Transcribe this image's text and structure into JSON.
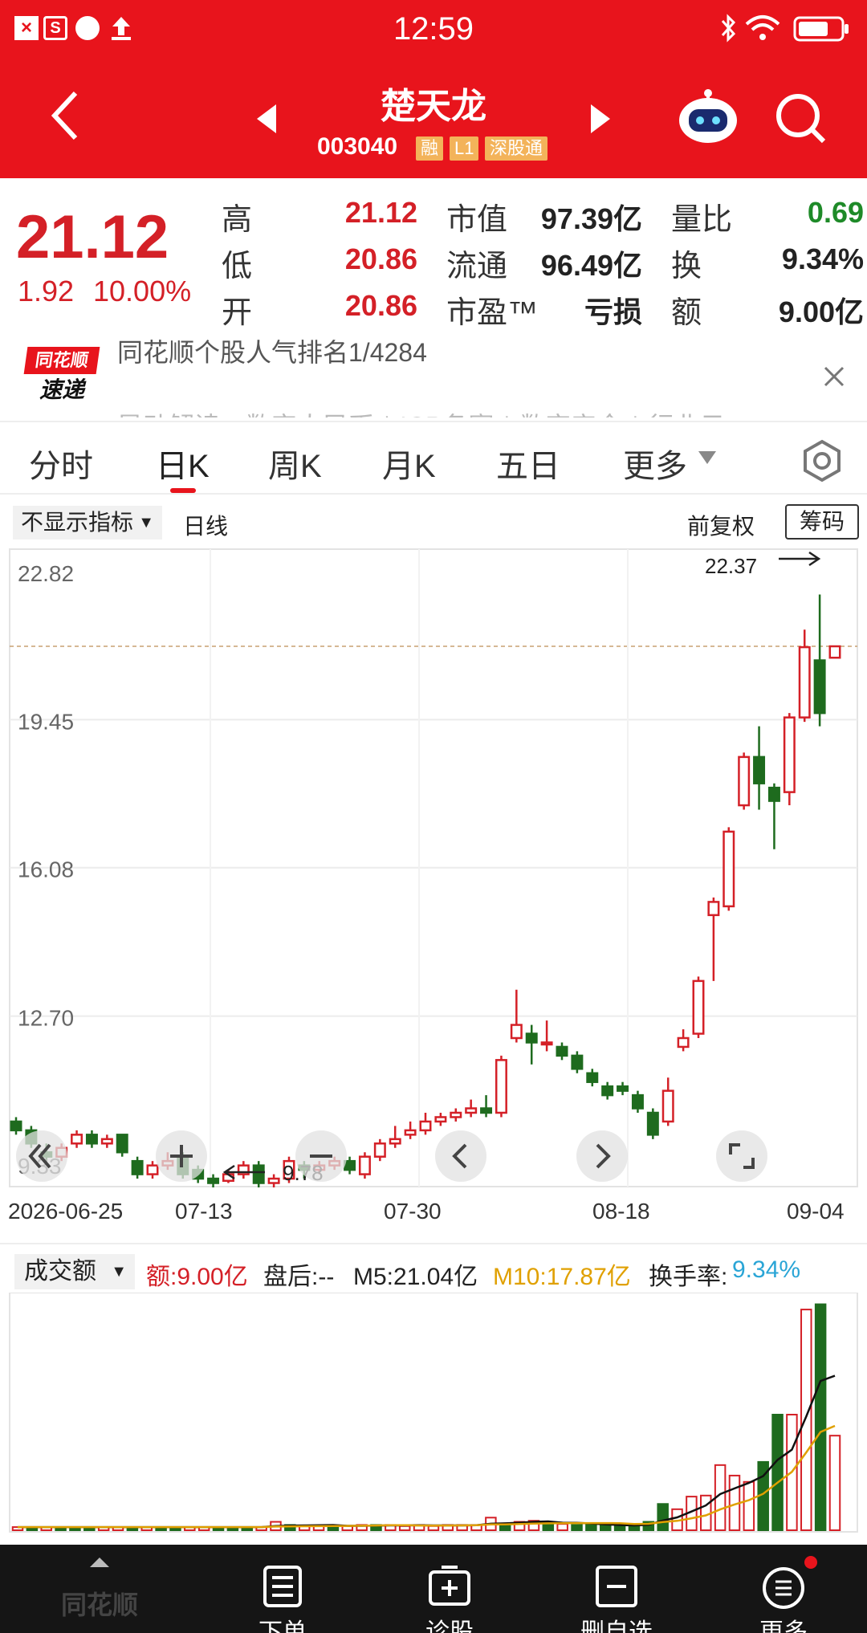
{
  "status_bar": {
    "time": "12:59"
  },
  "header": {
    "title": "楚天龙",
    "code": "003040",
    "badges": [
      "融",
      "L1",
      "深股通"
    ]
  },
  "quote": {
    "price": "21.12",
    "change": "1.92",
    "change_pct": "10.00%",
    "rows": [
      [
        {
          "label": "高",
          "value": "21.12"
        },
        {
          "label": "市值",
          "value": "97.39亿"
        },
        {
          "label": "量比",
          "value": "0.69"
        }
      ],
      [
        {
          "label": "低",
          "value": "20.86"
        },
        {
          "label": "流通",
          "value": "96.49亿"
        },
        {
          "label": "换",
          "value": "9.34%"
        }
      ],
      [
        {
          "label": "开",
          "value": "20.86"
        },
        {
          "label": "市盈™",
          "value": "亏损"
        },
        {
          "label": "额",
          "value": "9.00亿"
        }
      ]
    ]
  },
  "news": {
    "logo_top": "同花顺",
    "logo_bottom": "速递",
    "text": "同花顺个股人气排名1/4284",
    "text2": "异动解读：数字人民币＋ICP备案＋数字安全＋行业云"
  },
  "tabs": [
    "分时",
    "日K",
    "周K",
    "月K",
    "五日",
    "更多"
  ],
  "chart_toolbar": {
    "indicator": "不显示指标",
    "period": "日线",
    "adjust": "前复权",
    "chips": "筹码"
  },
  "chart_data": [
    {
      "type": "candlestick",
      "y_ticks": [
        "22.82",
        "19.45",
        "16.08",
        "12.70",
        "9.33"
      ],
      "x_labels": [
        "2026-06-25",
        "07-13",
        "07-30",
        "08-18",
        "09-04"
      ],
      "annotations": {
        "high": "22.37",
        "low": "9.78"
      },
      "last_close": 21.12,
      "candles": [
        [
          10.3,
          10.1,
          10.4,
          10.0
        ],
        [
          10.1,
          9.8,
          10.2,
          9.7
        ],
        [
          9.6,
          9.5,
          9.8,
          9.4
        ],
        [
          9.5,
          9.7,
          9.8,
          9.4
        ],
        [
          9.8,
          10.0,
          10.1,
          9.7
        ],
        [
          10.0,
          9.8,
          10.1,
          9.7
        ],
        [
          9.8,
          9.9,
          10.0,
          9.7
        ],
        [
          10.0,
          9.6,
          10.0,
          9.5
        ],
        [
          9.4,
          9.1,
          9.5,
          9.0
        ],
        [
          9.1,
          9.3,
          9.4,
          9.0
        ],
        [
          9.3,
          9.4,
          9.6,
          9.2
        ],
        [
          9.5,
          9.1,
          9.6,
          9.0
        ],
        [
          9.2,
          9.0,
          9.3,
          8.9
        ],
        [
          9.0,
          8.9,
          9.1,
          8.8
        ],
        [
          8.95,
          9.1,
          9.2,
          8.9
        ],
        [
          9.1,
          9.3,
          9.4,
          9.0
        ],
        [
          9.3,
          8.9,
          9.4,
          8.8
        ],
        [
          8.9,
          9.0,
          9.1,
          8.8
        ],
        [
          9.0,
          9.4,
          9.5,
          8.9
        ],
        [
          9.3,
          9.2,
          9.4,
          9.0
        ],
        [
          9.2,
          9.3,
          9.4,
          9.1
        ],
        [
          9.3,
          9.4,
          9.5,
          9.2
        ],
        [
          9.4,
          9.2,
          9.5,
          9.1
        ],
        [
          9.1,
          9.5,
          9.6,
          9.0
        ],
        [
          9.5,
          9.8,
          9.9,
          9.4
        ],
        [
          9.8,
          9.9,
          10.2,
          9.7
        ],
        [
          10.0,
          10.1,
          10.3,
          9.9
        ],
        [
          10.1,
          10.3,
          10.5,
          10.0
        ],
        [
          10.3,
          10.4,
          10.5,
          10.2
        ],
        [
          10.4,
          10.5,
          10.6,
          10.3
        ],
        [
          10.5,
          10.6,
          10.8,
          10.4
        ],
        [
          10.6,
          10.5,
          10.9,
          10.4
        ],
        [
          10.5,
          11.7,
          11.8,
          10.4
        ],
        [
          12.2,
          12.5,
          13.3,
          12.1
        ],
        [
          12.3,
          12.1,
          12.5,
          11.6
        ],
        [
          12.1,
          12.1,
          12.6,
          11.9
        ],
        [
          12.0,
          11.8,
          12.1,
          11.7
        ],
        [
          11.8,
          11.5,
          11.9,
          11.4
        ],
        [
          11.4,
          11.2,
          11.5,
          11.1
        ],
        [
          11.1,
          10.9,
          11.2,
          10.8
        ],
        [
          11.1,
          11.0,
          11.2,
          10.9
        ],
        [
          10.9,
          10.6,
          11.0,
          10.5
        ],
        [
          10.5,
          10.0,
          10.6,
          9.9
        ],
        [
          10.3,
          11.0,
          11.3,
          10.2
        ],
        [
          12.0,
          12.2,
          12.4,
          11.9
        ],
        [
          12.3,
          13.5,
          13.6,
          12.2
        ],
        [
          15.0,
          15.3,
          15.4,
          13.5
        ],
        [
          15.2,
          16.9,
          17.0,
          15.1
        ],
        [
          17.5,
          18.6,
          18.7,
          17.4
        ],
        [
          18.6,
          18.0,
          19.3,
          17.4
        ],
        [
          17.9,
          17.6,
          18.0,
          16.5
        ],
        [
          17.8,
          19.5,
          19.6,
          17.5
        ],
        [
          19.5,
          21.1,
          21.5,
          19.4
        ],
        [
          20.8,
          19.6,
          22.3,
          19.3
        ],
        [
          20.86,
          21.12,
          21.12,
          20.86
        ]
      ]
    },
    {
      "type": "bar",
      "title": "成交额",
      "metrics": {
        "amount": "额:9.00亿",
        "after": "盘后:--",
        "ma5": "M5:21.04亿",
        "ma10": "M10:17.87亿",
        "turnover_label": "换手率:",
        "turnover": "9.34%"
      },
      "values": [
        0.3,
        0.3,
        0.3,
        0.3,
        0.3,
        0.3,
        0.3,
        0.3,
        0.3,
        0.3,
        0.3,
        0.3,
        0.3,
        0.3,
        0.3,
        0.3,
        0.3,
        0.3,
        0.8,
        0.5,
        0.4,
        0.4,
        0.4,
        0.4,
        0.5,
        0.5,
        0.5,
        0.4,
        0.5,
        0.4,
        0.5,
        0.5,
        0.5,
        1.2,
        0.6,
        0.8,
        0.9,
        0.7,
        0.6,
        0.5,
        0.5,
        0.5,
        0.4,
        0.4,
        0.8,
        2.5,
        2.0,
        3.2,
        3.3,
        6.2,
        5.2,
        4.6,
        6.5,
        11.0,
        11.0,
        21.0,
        21.5,
        9.0
      ]
    }
  ],
  "bottom_nav": {
    "items": [
      "同花顺",
      "下单",
      "诊股",
      "删自选",
      "更多"
    ]
  }
}
